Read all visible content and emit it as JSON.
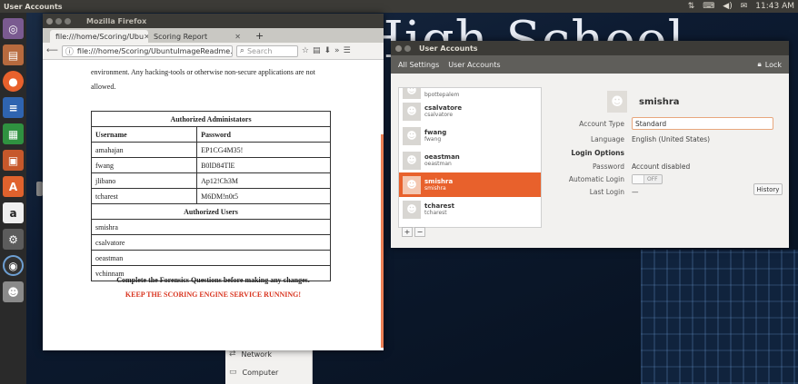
{
  "top_panel": {
    "title": "User Accounts",
    "tray": [
      {
        "icon": "network-arrows-icon",
        "glyph": "⇅"
      },
      {
        "icon": "keyboard-icon",
        "glyph": "⌨"
      },
      {
        "icon": "volume-icon",
        "glyph": "◀)"
      },
      {
        "icon": "mail-icon",
        "glyph": "✉"
      }
    ],
    "clock": "11:43 AM"
  },
  "wallpaper": {
    "title_text": "High School"
  },
  "launcher": {
    "items": [
      {
        "name": "search-icon",
        "glyph": "◎"
      },
      {
        "name": "files-icon",
        "glyph": "▤"
      },
      {
        "name": "firefox-icon",
        "glyph": "●"
      },
      {
        "name": "writer-icon",
        "glyph": "≡"
      },
      {
        "name": "calc-icon",
        "glyph": "▦"
      },
      {
        "name": "impress-icon",
        "glyph": "▣"
      },
      {
        "name": "software-center-icon",
        "glyph": "A"
      },
      {
        "name": "amazon-icon",
        "glyph": "a"
      },
      {
        "name": "system-settings-icon",
        "glyph": "⚙"
      },
      {
        "name": "scoring-icon",
        "glyph": "◉"
      },
      {
        "name": "users-icon",
        "glyph": "☻"
      }
    ]
  },
  "firefox": {
    "window_title": "Mozilla Firefox",
    "tabs": [
      {
        "label": "file:///home/Scoring/Ubu",
        "active": true
      },
      {
        "label": "Scoring Report",
        "active": false
      }
    ],
    "new_tab": "+",
    "url": "file:///home/Scoring/UbuntuImageReadme.",
    "search_placeholder": "Search",
    "document": {
      "paragraph": "environment. Any hacking-tools or otherwise non-secure applications are not allowed.",
      "admins_heading": "Authorized Administators",
      "col_username": "Username",
      "col_password": "Password",
      "admins": [
        {
          "username": "amahajan",
          "password": "EP1CG4M35!"
        },
        {
          "username": "fwang",
          "password": "B0lD84TlE"
        },
        {
          "username": "jlibano",
          "password": "Ap12!Ch3M"
        },
        {
          "username": "tcharest",
          "password": "M6DM!n0t5"
        }
      ],
      "users_heading": "Authorized Users",
      "users": [
        "smishra",
        "csalvatore",
        "oeastman",
        "vchinnam"
      ],
      "note": "Complete the Forensics Questions before making any changes.",
      "warning": "KEEP THE SCORING ENGINE SERVICE RUNNING!"
    }
  },
  "settings_back": {
    "items": [
      {
        "label": "Network",
        "icon": "network-icon"
      },
      {
        "label": "Computer",
        "icon": "computer-icon"
      }
    ]
  },
  "user_accounts": {
    "window_title": "User Accounts",
    "toolbar": {
      "all_settings": "All Settings",
      "current": "User Accounts",
      "lock": "Lock"
    },
    "users": [
      {
        "display": "bpottepalem",
        "login": "bpottepalem",
        "partial": true,
        "selected": false
      },
      {
        "display": "csalvatore",
        "login": "csalvatore",
        "partial": false,
        "selected": false
      },
      {
        "display": "fwang",
        "login": "fwang",
        "partial": false,
        "selected": false
      },
      {
        "display": "oeastman",
        "login": "oeastman",
        "partial": false,
        "selected": false
      },
      {
        "display": "smishra",
        "login": "smishra",
        "partial": false,
        "selected": true
      },
      {
        "display": "tcharest",
        "login": "tcharest",
        "partial": false,
        "selected": false
      }
    ],
    "list_buttons": {
      "add": "+",
      "remove": "−"
    },
    "detail": {
      "username": "smishra",
      "account_type_label": "Account Type",
      "account_type_value": "Standard",
      "language_label": "Language",
      "language_value": "English (United States)",
      "login_options_label": "Login Options",
      "password_label": "Password",
      "password_value": "Account disabled",
      "auto_login_label": "Automatic Login",
      "auto_login_value": "OFF",
      "last_login_label": "Last Login",
      "last_login_value": "—",
      "history_button": "History"
    }
  }
}
